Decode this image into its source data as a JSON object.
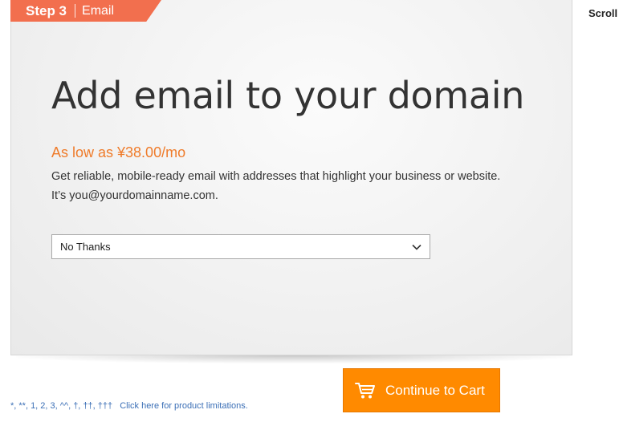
{
  "step": {
    "number_label": "Step 3",
    "name": "Email"
  },
  "scroll_label": "Scroll",
  "offer": {
    "headline": "Add email to your domain",
    "price": "As low as ¥38.00/mo",
    "description": "Get reliable, mobile-ready email with addresses that highlight your business or website. It’s you@yourdomainname.com."
  },
  "email_select": {
    "selected": "No Thanks",
    "icon": "chevron-down-icon"
  },
  "cart_button": {
    "label": "Continue to Cart",
    "icon": "shopping-cart-icon"
  },
  "footnotes": {
    "symbols": "*, **, 1, 2, 3, ^^, †, ††, †††",
    "limitations_link": "Click here for product limitations."
  },
  "colors": {
    "step_tab": "#f26f4e",
    "price": "#ef7b2a",
    "cart_button": "#ff8a00",
    "link": "#3b6fb6"
  }
}
